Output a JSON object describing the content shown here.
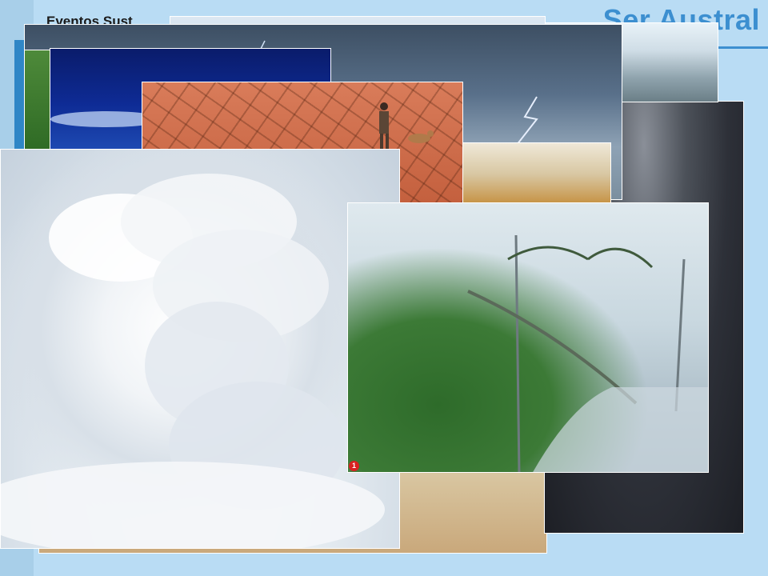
{
  "slide": {
    "title": "Eventos Sust",
    "brand": "Ser Austral"
  },
  "photos": [
    {
      "id": "sky-lower",
      "subject": "dusty sand / lower sky"
    },
    {
      "id": "dark-storm",
      "subject": "dark storm clouds"
    },
    {
      "id": "flood",
      "subject": "flooded landscape"
    },
    {
      "id": "lightning",
      "subject": "storm with lightning"
    },
    {
      "id": "green",
      "subject": "green vegetation"
    },
    {
      "id": "night-sky",
      "subject": "deep blue sky"
    },
    {
      "id": "drought-water",
      "subject": "cracked ground near water"
    },
    {
      "id": "drought",
      "subject": "cracked earth with man and dog"
    },
    {
      "id": "ash-cloud",
      "subject": "volcanic ash cloud"
    },
    {
      "id": "hurricane",
      "subject": "hurricane-bent palm trees"
    }
  ],
  "badge": {
    "label": "1",
    "color": "#d92020"
  },
  "colors": {
    "brand": "#3c8fd0",
    "background": "#b9dcf4"
  }
}
